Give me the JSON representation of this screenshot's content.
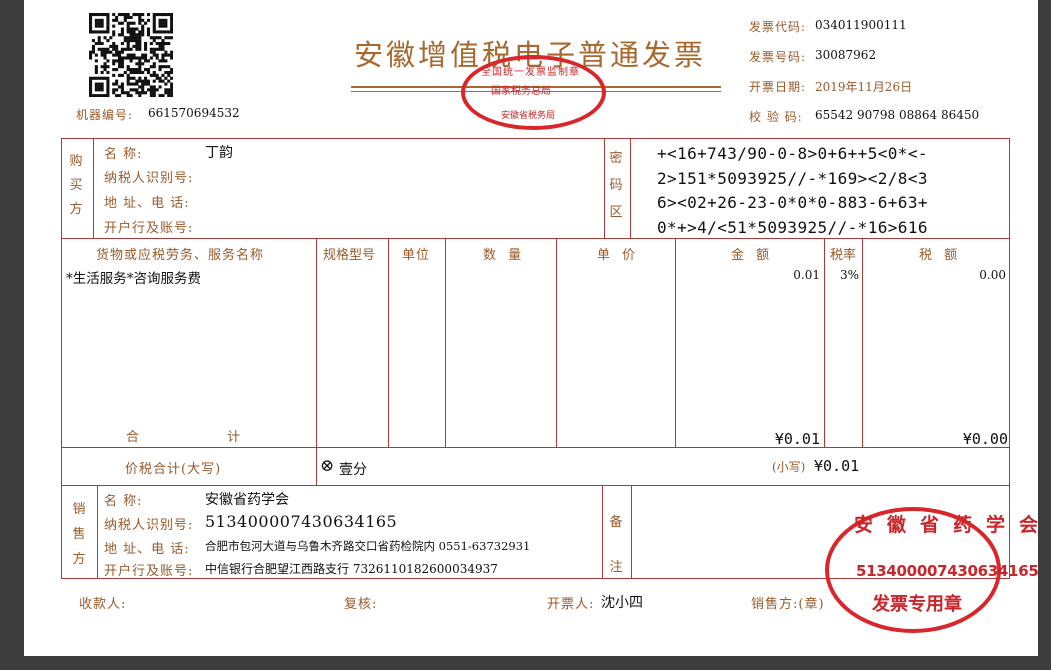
{
  "header": {
    "title": "安徽增值税电子普通发票",
    "machine_no_label": "机器编号:",
    "machine_no": "661570694532",
    "code_label": "发票代码:",
    "code": "034011900111",
    "number_label": "发票号码:",
    "number": "30087962",
    "date_label": "开票日期:",
    "date": "2019年11月26日",
    "check_label": "校 验 码:",
    "check": "65542 90798 08864 86450"
  },
  "tax_seal": {
    "top_text": "全国统一发票监制章",
    "middle_text": "国家税务总局",
    "bottom_text": "安徽省税务局"
  },
  "buyer": {
    "section": "购买方",
    "name_label": "名 称:",
    "name": "丁韵",
    "taxid_label": "纳税人识别号:",
    "taxid": "",
    "address_label": "地 址、电 话:",
    "address": "",
    "bank_label": "开户行及账号:",
    "bank": ""
  },
  "cipher": {
    "section": "密码区",
    "lines": [
      "+<16+743/90-0-8>0+6++5<0*<-",
      "2>151*5093925//-*169><2/8<3",
      "6><02+26-23-0*0*0-883-6+63+",
      "0*+>4/<51*5093925//-*16>616"
    ]
  },
  "items": {
    "headers": [
      "货物或应税劳务、服务名称",
      "规格型号",
      "单位",
      "数 量",
      "单 价",
      "金 额",
      "税率",
      "税 额"
    ],
    "rows": [
      {
        "name": "*生活服务*咨询服务费",
        "spec": "",
        "unit": "",
        "qty": "",
        "price": "",
        "amount": "0.01",
        "rate": "3%",
        "tax": "0.00"
      }
    ],
    "total_label": "合 计",
    "total_amount": "¥0.01",
    "total_tax": "¥0.00"
  },
  "grand_total": {
    "label": "价税合计(大写)",
    "upper": "壹分",
    "lower_label": "(小写)",
    "lower": "¥0.01"
  },
  "seller": {
    "section": "销售方",
    "name_label": "名 称:",
    "name": "安徽省药学会",
    "taxid_label": "纳税人识别号:",
    "taxid": "513400007430634165",
    "address_label": "地 址、电 话:",
    "address": "合肥市包河大道与乌鲁木齐路交口省药检院内 0551-63732931",
    "bank_label": "开户行及账号:",
    "bank": "中信银行合肥望江西路支行 7326110182600034937",
    "remark_label": "备注"
  },
  "seller_seal": {
    "arc_text": "安徽省药学会",
    "taxid": "513400007430634165",
    "bottom_text": "发票专用章"
  },
  "footer": {
    "payee_label": "收款人:",
    "payee": "",
    "reviewer_label": "复核:",
    "reviewer": "",
    "issuer_label": "开票人:",
    "issuer": "沈小四",
    "seller_label": "销售方:(章)"
  }
}
